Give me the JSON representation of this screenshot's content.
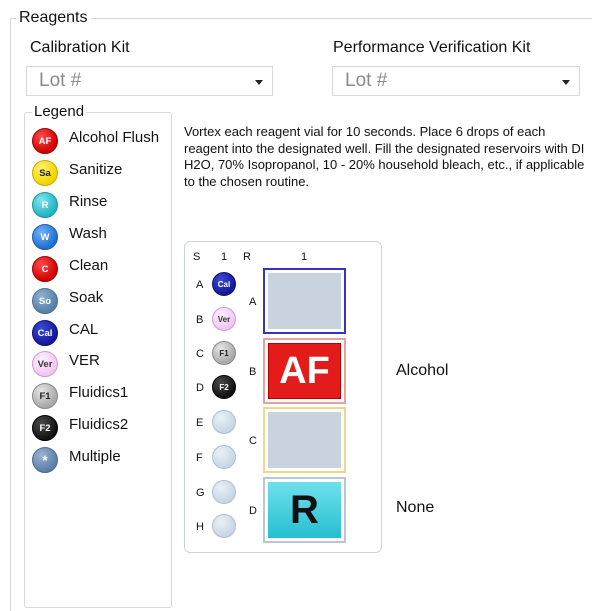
{
  "group": {
    "title": "Reagents"
  },
  "calibration_kit": {
    "label": "Calibration Kit",
    "value": "Lot #"
  },
  "performance_kit": {
    "label": "Performance Verification Kit",
    "value": "Lot #"
  },
  "legend": {
    "title": "Legend",
    "items": [
      {
        "code": "AF",
        "label": "Alcohol Flush",
        "class": "af",
        "color": "#e00000"
      },
      {
        "code": "Sa",
        "label": "Sanitize",
        "class": "sa",
        "color": "#f2d400"
      },
      {
        "code": "R",
        "label": "Rinse",
        "class": "r",
        "color": "#22b3c3"
      },
      {
        "code": "W",
        "label": "Wash",
        "class": "w",
        "color": "#1f6fd0"
      },
      {
        "code": "C",
        "label": "Clean",
        "class": "c",
        "color": "#e00000"
      },
      {
        "code": "So",
        "label": "Soak",
        "class": "so",
        "color": "#5680a8"
      },
      {
        "code": "Cal",
        "label": "CAL",
        "class": "cal",
        "color": "#12199a"
      },
      {
        "code": "Ver",
        "label": "VER",
        "class": "ver",
        "color": "#f2c6f2"
      },
      {
        "code": "F1",
        "label": "Fluidics1",
        "class": "f1",
        "color": "#a8a8a8"
      },
      {
        "code": "F2",
        "label": "Fluidics2",
        "class": "f2",
        "color": "#111111"
      },
      {
        "code": "*",
        "label": "Multiple",
        "class": "mult",
        "color": "#5b7ea8"
      }
    ]
  },
  "instructions": "Vortex each reagent vial for 10 seconds. Place 6 drops of each reagent into the designated well. Fill the designated reservoirs with DI H2O, 70% Isopropanol, 10 - 20% household bleach, etc., if applicable to the chosen routine.",
  "plate": {
    "headers": {
      "s": "S",
      "col1": "1",
      "r": "R",
      "res_col": "1"
    },
    "wells": [
      {
        "row": "A",
        "code": "Cal",
        "class": "cal"
      },
      {
        "row": "B",
        "code": "Ver",
        "class": "ver"
      },
      {
        "row": "C",
        "code": "F1",
        "class": "f1"
      },
      {
        "row": "D",
        "code": "F2",
        "class": "f2"
      },
      {
        "row": "E",
        "code": "",
        "class": "empty"
      },
      {
        "row": "F",
        "code": "",
        "class": "empty"
      },
      {
        "row": "G",
        "code": "",
        "class": "empty"
      },
      {
        "row": "H",
        "code": "",
        "class": "empty"
      }
    ],
    "reservoirs": [
      {
        "row": "A",
        "code": "",
        "side_label": ""
      },
      {
        "row": "B",
        "code": "AF",
        "side_label": "Alcohol"
      },
      {
        "row": "C",
        "code": "",
        "side_label": ""
      },
      {
        "row": "D",
        "code": "R",
        "side_label": "None"
      }
    ]
  }
}
